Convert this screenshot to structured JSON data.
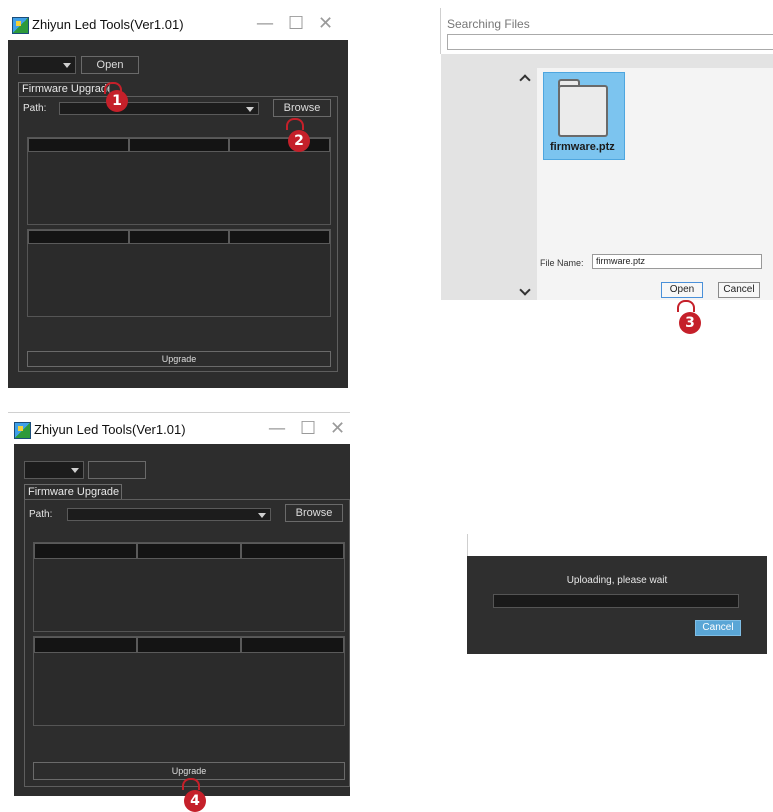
{
  "window1": {
    "title": "Zhiyun Led Tools(Ver1.01)",
    "open_button": "Open",
    "tab_label": "Firmware Upgrade",
    "path_label": "Path:",
    "browse_button": "Browse",
    "upgrade_button": "Upgrade"
  },
  "window2": {
    "title": "Zhiyun Led Tools(Ver1.01)",
    "tab_label": "Firmware Upgrade",
    "path_label": "Path:",
    "browse_button": "Browse",
    "upgrade_button": "Upgrade"
  },
  "file_dialog": {
    "title": "Searching Files",
    "file_item": "firmware.ptz",
    "file_name_label": "File Name:",
    "file_name_value": "firmware.ptz",
    "open_button": "Open",
    "cancel_button": "Cancel"
  },
  "upload_dialog": {
    "message": "Uploading, please wait",
    "cancel_button": "Cancel",
    "progress": 0
  },
  "steps": [
    "1",
    "2",
    "3",
    "4"
  ],
  "colors": {
    "window_bg": "#2d2d2d",
    "step_badge": "#c5202a",
    "selection": "#7cc4ef",
    "cancel_button": "#5aa6d6"
  },
  "icons": [
    "app-icon",
    "minimize-icon",
    "maximize-icon",
    "close-icon",
    "dropdown-arrow-icon",
    "folder-icon",
    "scroll-up-icon",
    "scroll-down-icon",
    "pointer-hand-icon"
  ],
  "window_controls": [
    "—",
    "☐",
    "✕"
  ]
}
